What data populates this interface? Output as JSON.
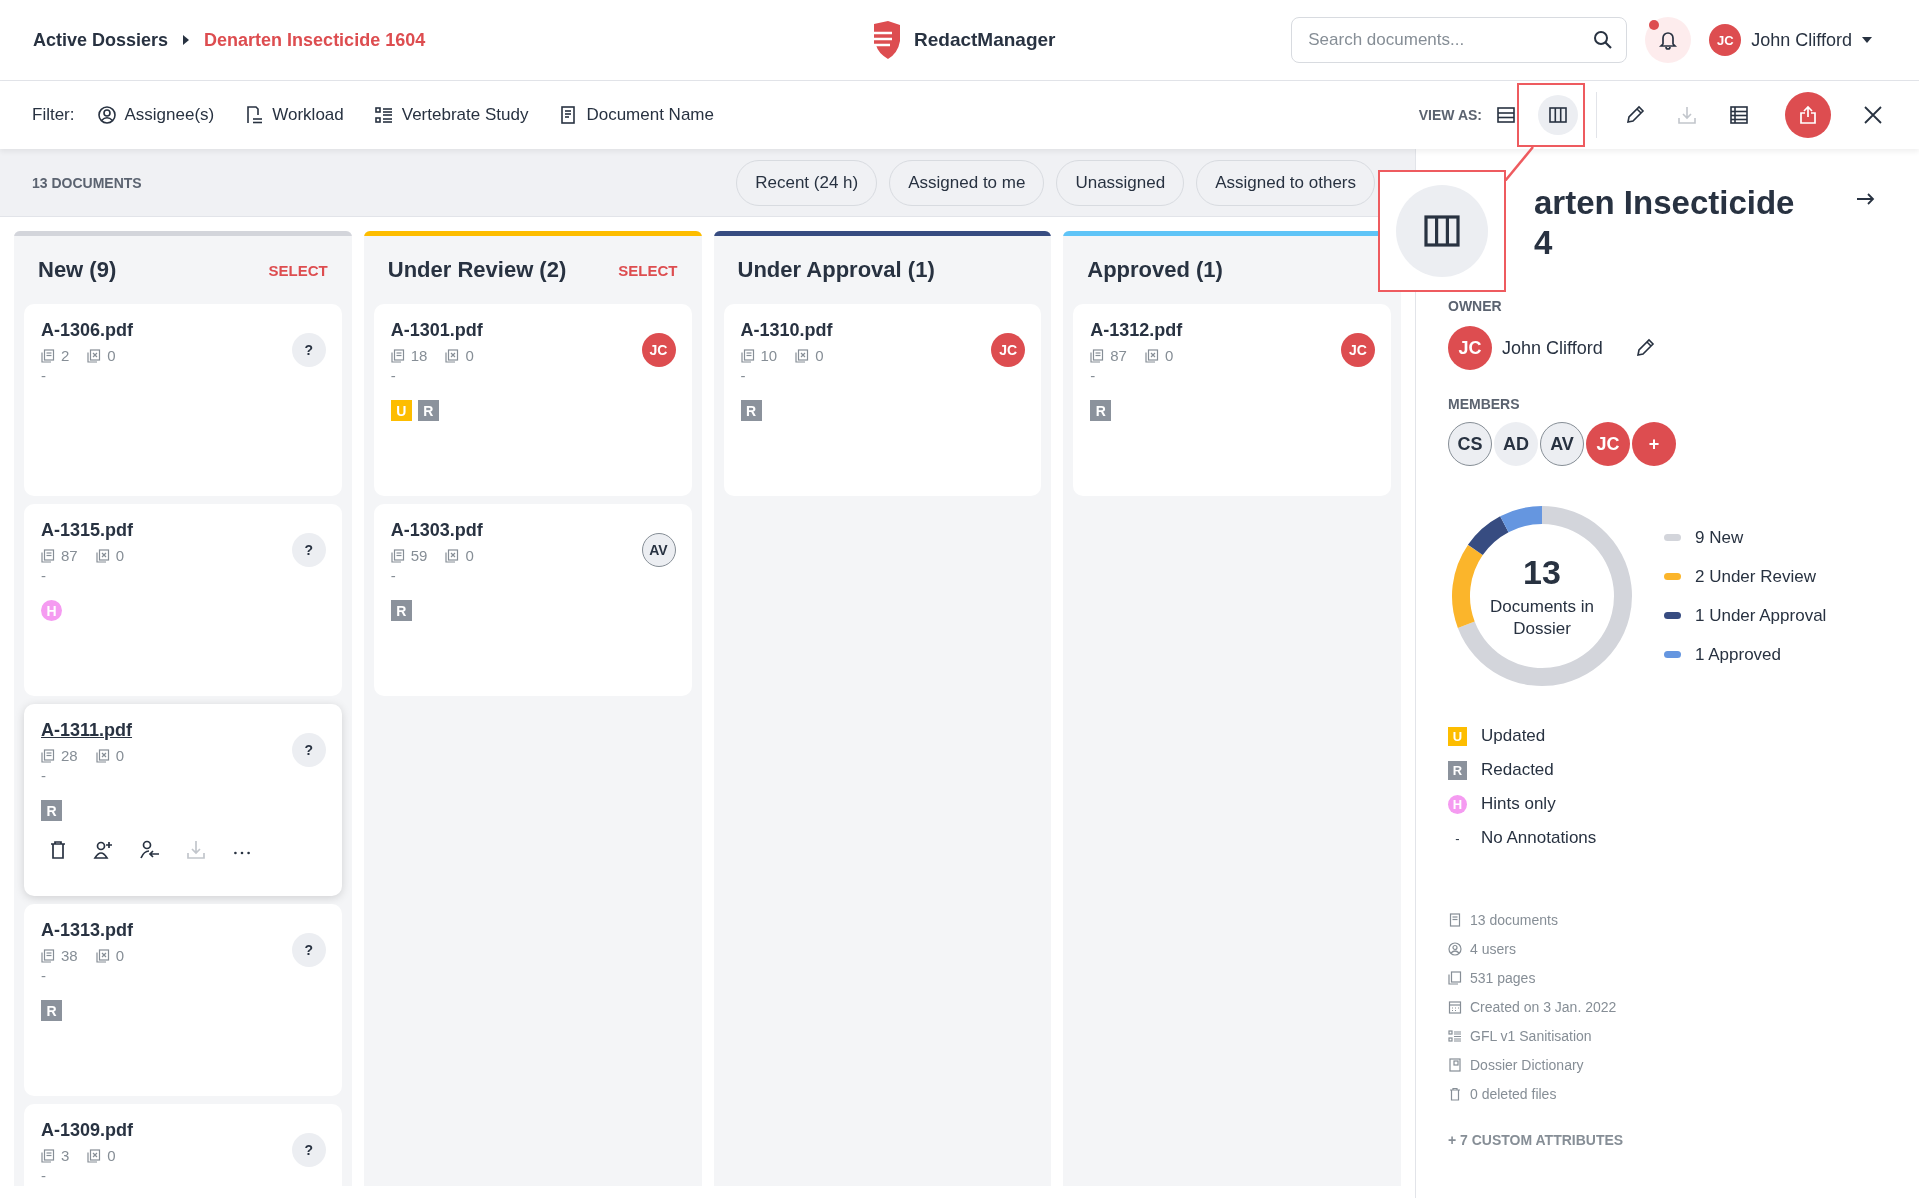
{
  "breadcrumb": {
    "parent": "Active Dossiers",
    "current": "Denarten Insecticide 1604"
  },
  "app": {
    "name": "RedactManager"
  },
  "search": {
    "placeholder": "Search documents..."
  },
  "notifications": {
    "unread": true
  },
  "user": {
    "initials": "JC",
    "name": "John Clifford"
  },
  "filter_bar": {
    "label": "Filter:",
    "filters": [
      {
        "kind": "assignee",
        "label": "Assignee(s)"
      },
      {
        "kind": "workload",
        "label": "Workload"
      },
      {
        "kind": "study",
        "label": "Vertebrate Study"
      },
      {
        "kind": "document",
        "label": "Document Name"
      }
    ],
    "view_label": "VIEW AS:",
    "views": [
      {
        "kind": "list",
        "selected": false
      },
      {
        "kind": "board",
        "selected": true
      }
    ],
    "actions": [
      {
        "kind": "edit",
        "disabled": false
      },
      {
        "kind": "download",
        "disabled": true
      },
      {
        "kind": "table",
        "disabled": false
      },
      {
        "kind": "export",
        "disabled": false
      },
      {
        "kind": "close",
        "disabled": false
      }
    ]
  },
  "summary": {
    "count": "13 DOCUMENTS",
    "quick_filters": [
      {
        "label": "Recent (24 h)",
        "selected": false
      },
      {
        "label": "Assigned to me",
        "selected": false
      },
      {
        "label": "Unassigned",
        "selected": false
      },
      {
        "label": "Assigned to others",
        "selected": false
      }
    ]
  },
  "columns": [
    {
      "title": "New (9)",
      "select": "SELECT",
      "color": "#d3d5db",
      "cards": [
        {
          "name": "A-1306.pdf",
          "pages": "2",
          "excluded": "0",
          "note": "-",
          "assignee": {
            "kind": "unassigned",
            "text": "?"
          },
          "hovered": false
        },
        {
          "name": "A-1315.pdf",
          "pages": "87",
          "excluded": "0",
          "note": "-",
          "badges": [
            {
              "kind": "hints",
              "text": "H"
            }
          ],
          "assignee": {
            "kind": "unassigned",
            "text": "?"
          },
          "hovered": false
        },
        {
          "name": "A-1311.pdf",
          "pages": "28",
          "excluded": "0",
          "note": "-",
          "badges": [
            {
              "kind": "redacted",
              "text": "R"
            }
          ],
          "assignee": {
            "kind": "unassigned",
            "text": "?"
          },
          "hovered": true,
          "actions": [
            {
              "kind": "delete",
              "disabled": false
            },
            {
              "kind": "assign",
              "disabled": false
            },
            {
              "kind": "assign-me",
              "disabled": false
            },
            {
              "kind": "download",
              "disabled": true
            },
            {
              "kind": "more",
              "disabled": false
            }
          ]
        },
        {
          "name": "A-1313.pdf",
          "pages": "38",
          "excluded": "0",
          "note": "-",
          "badges": [
            {
              "kind": "redacted",
              "text": "R"
            }
          ],
          "assignee": {
            "kind": "unassigned",
            "text": "?"
          },
          "hovered": false
        },
        {
          "name": "A-1309.pdf",
          "pages": "3",
          "excluded": "0",
          "note": "-",
          "assignee": {
            "kind": "unassigned",
            "text": "?"
          },
          "hovered": false
        }
      ]
    },
    {
      "title": "Under Review (2)",
      "select": "SELECT",
      "color": "#fdbd00",
      "cards": [
        {
          "name": "A-1301.pdf",
          "pages": "18",
          "excluded": "0",
          "note": "-",
          "badges": [
            {
              "kind": "updated",
              "text": "U"
            },
            {
              "kind": "redacted",
              "text": "R"
            }
          ],
          "assignee": {
            "kind": "owner",
            "text": "JC"
          },
          "hovered": false
        },
        {
          "name": "A-1303.pdf",
          "pages": "59",
          "excluded": "0",
          "note": "-",
          "badges": [
            {
              "kind": "redacted",
              "text": "R"
            }
          ],
          "assignee": {
            "kind": "member",
            "text": "AV"
          },
          "hovered": false
        }
      ]
    },
    {
      "title": "Under Approval (1)",
      "color": "#374c81",
      "cards": [
        {
          "name": "A-1310.pdf",
          "pages": "10",
          "excluded": "0",
          "note": "-",
          "badges": [
            {
              "kind": "redacted",
              "text": "R"
            }
          ],
          "assignee": {
            "kind": "owner",
            "text": "JC"
          },
          "hovered": false
        }
      ]
    },
    {
      "title": "Approved (1)",
      "color": "#5fc4f7",
      "cards": [
        {
          "name": "A-1312.pdf",
          "pages": "87",
          "excluded": "0",
          "note": "-",
          "badges": [
            {
              "kind": "redacted",
              "text": "R"
            }
          ],
          "assignee": {
            "kind": "owner",
            "text": "JC"
          },
          "hovered": false
        }
      ]
    }
  ],
  "details": {
    "title_lines": [
      "arten Insecticide",
      "4"
    ],
    "owner_label": "OWNER",
    "owner": {
      "initials": "JC",
      "name": "John Clifford"
    },
    "members_label": "MEMBERS",
    "members": [
      {
        "kind": "outlined",
        "text": "CS"
      },
      {
        "kind": "plain",
        "text": "AD"
      },
      {
        "kind": "outlined",
        "text": "AV"
      },
      {
        "kind": "owner",
        "text": "JC"
      },
      {
        "kind": "add",
        "text": "+"
      }
    ],
    "chart_data": {
      "type": "donut",
      "categories": [
        "9 New",
        "2 Under Review",
        "1 Under Approval",
        "1 Approved"
      ],
      "values": [
        9,
        2,
        1,
        1
      ]
    },
    "chart_center": {
      "value": "13",
      "label": "Documents in Dossier"
    },
    "legend": [
      {
        "color": "#d3d5db"
      },
      {
        "color": "#fbb52b"
      },
      {
        "color": "#374c81"
      },
      {
        "color": "#6596e0"
      }
    ],
    "badge_legend": [
      {
        "kind": "updated",
        "text": "U",
        "label": "Updated"
      },
      {
        "kind": "redacted",
        "text": "R",
        "label": "Redacted"
      },
      {
        "kind": "hints",
        "text": "H",
        "label": "Hints only"
      },
      {
        "kind": "none",
        "text": "-",
        "label": "No Annotations"
      }
    ],
    "stats": [
      {
        "kind": "documents",
        "label": "13 documents"
      },
      {
        "kind": "users",
        "label": "4 users"
      },
      {
        "kind": "pages",
        "label": "531 pages"
      },
      {
        "kind": "created",
        "label": "Created on 3 Jan. 2022"
      },
      {
        "kind": "template",
        "label": "GFL v1 Sanitisation"
      },
      {
        "kind": "dictionary",
        "label": "Dossier Dictionary"
      },
      {
        "kind": "deleted",
        "label": "0 deleted files"
      }
    ],
    "custom_attributes": "+ 7 CUSTOM ATTRIBUTES"
  },
  "callout": {
    "shown": true
  }
}
